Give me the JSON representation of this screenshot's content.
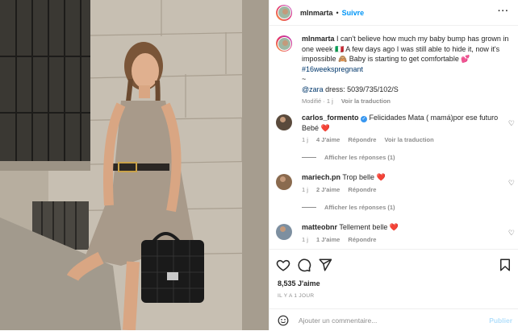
{
  "post": {
    "username": "mlnmarta",
    "follow_label": "Suivre",
    "more_icon": "more-icon",
    "caption_user": "mlnmarta",
    "caption_line1": " I can't believe how much my baby bump has grown in one week ",
    "caption_line2": " A few days ago I was still able to hide it, now it's impossible ",
    "caption_line3": " Baby is starting to get comfortable ",
    "hashtag": "#16weekspregnant",
    "tilde": "~",
    "zara_tag": "@zara",
    "dress_text": " dress: 5039/735/102/S",
    "caption_meta_modified": "Modifié · 1 j",
    "caption_meta_translate": "Voir la traduction"
  },
  "comments": [
    {
      "user": "carlos_formento",
      "text": " Felicidades Mata ( mamá)por ese futuro Bebé ",
      "time": "1 j",
      "likes": "4 J'aime",
      "reply": "Répondre",
      "translate": "Voir la traduction",
      "replies": "Afficher les réponses (1)"
    },
    {
      "user": "mariech.pn",
      "text": " Trop belle ",
      "time": "1 j",
      "likes": "2 J'aime",
      "reply": "Répondre",
      "replies": "Afficher les réponses (1)"
    },
    {
      "user": "matteobnr",
      "text": " Tellement belle ",
      "time": "1 j",
      "likes": "1 J'aime",
      "reply": "Répondre"
    }
  ],
  "actions": {
    "likes": "8,535 J'aime",
    "posted": "IL Y A 1 JOUR",
    "comment_placeholder": "Ajouter un commentaire...",
    "publish": "Publier"
  },
  "colors": {
    "accent": "#0095f6",
    "heart": "#ed4956",
    "muted": "#8e8e8e"
  }
}
